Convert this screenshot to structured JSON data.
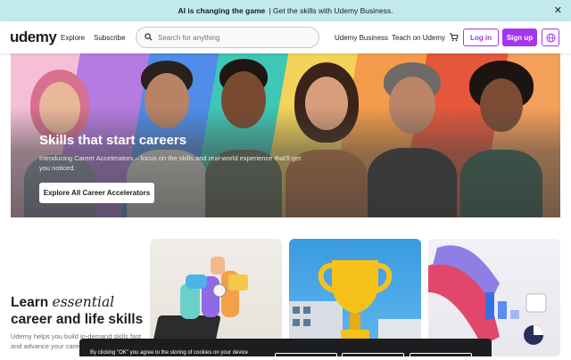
{
  "announcement": {
    "strong": "AI is changing the game",
    "text": "| Get the skills with Udemy Business."
  },
  "header": {
    "logo": "udemy",
    "nav_left": [
      "Explore",
      "Subscribe"
    ],
    "search_placeholder": "Search for anything",
    "nav_right": [
      "Udemy Business",
      "Teach on Udemy"
    ],
    "login": "Log in",
    "signup": "Sign up"
  },
  "hero": {
    "title": "Skills that start careers",
    "subtitle": "Introducing Career Accelerators – focus on the skills and real-world experience that'll get you noticed.",
    "button": "Explore All Career Accelerators"
  },
  "learn": {
    "title_prefix": "Learn ",
    "title_em": "essential",
    "title_suffix": "career and life skills",
    "body": "Udemy helps you build in-demand skills fast and advance your career"
  },
  "cookie": {
    "text": "By clicking \"OK\" you agree to the storing of cookies on your device"
  },
  "colors": {
    "brand": "#a435f0",
    "announce_bg": "#c2e9eb",
    "text": "#1c1d1f"
  }
}
